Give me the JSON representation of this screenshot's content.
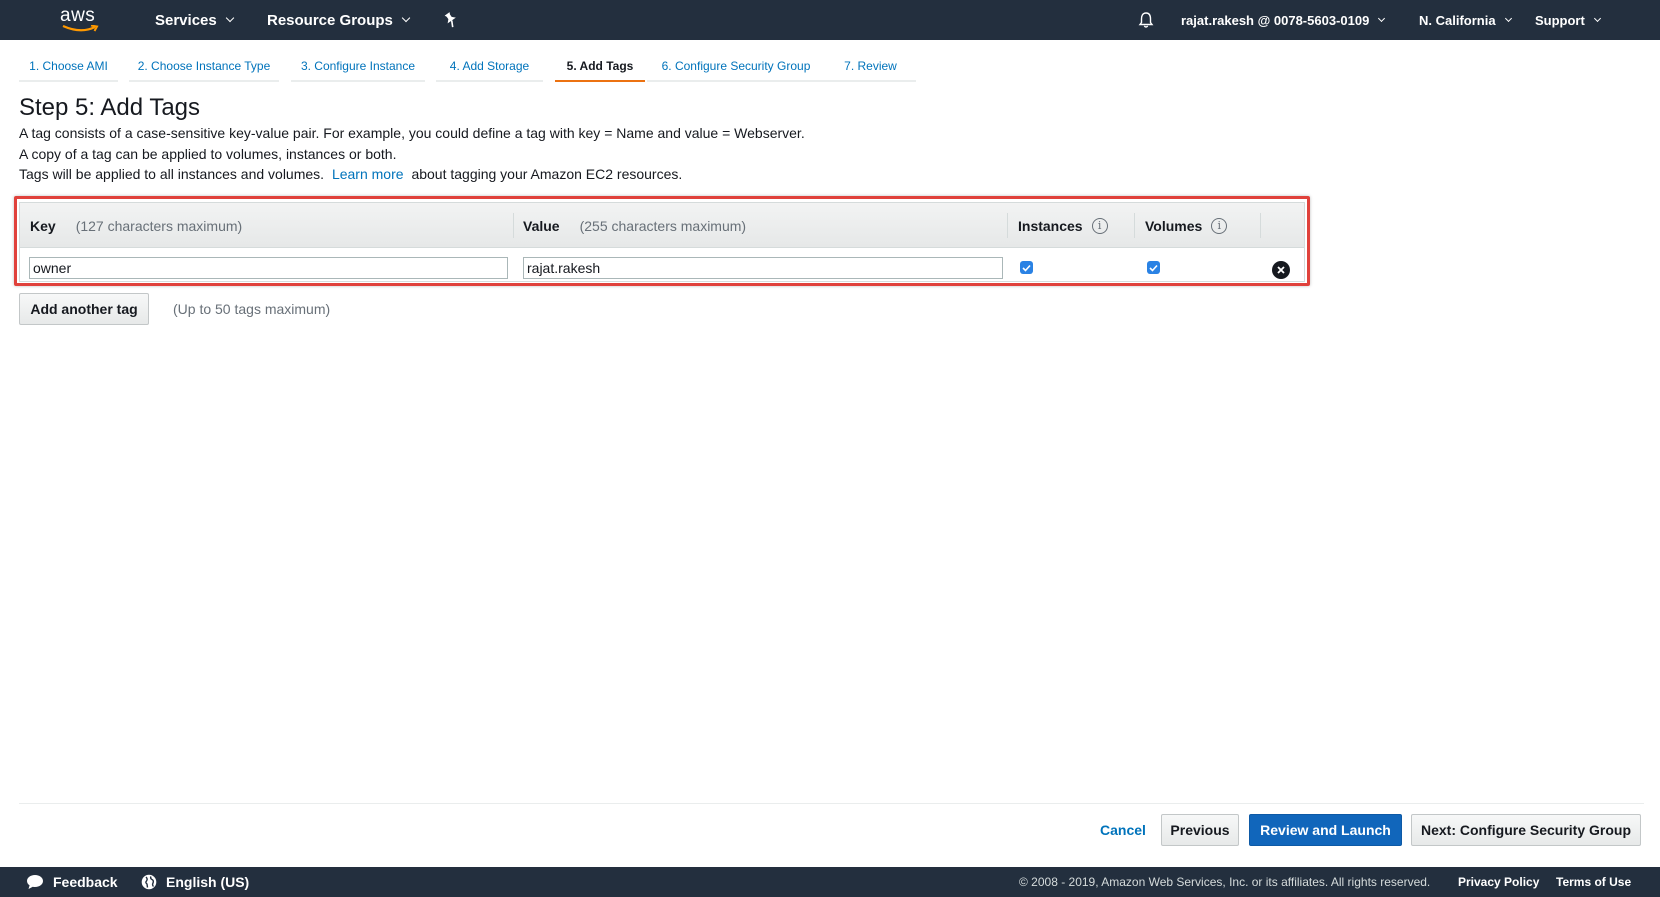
{
  "header": {
    "logo_text": "aws",
    "services": "Services",
    "resource_groups": "Resource Groups",
    "account": "rajat.rakesh @ 0078-5603-0109",
    "region": "N. California",
    "support": "Support",
    "icons": [
      "pin-icon",
      "bell-icon"
    ]
  },
  "wizard": {
    "tabs": [
      {
        "label": "1. Choose AMI"
      },
      {
        "label": "2. Choose Instance Type"
      },
      {
        "label": "3. Configure Instance"
      },
      {
        "label": "4. Add Storage"
      },
      {
        "label": "5. Add Tags",
        "active": true
      },
      {
        "label": "6. Configure Security Group"
      },
      {
        "label": "7. Review"
      }
    ]
  },
  "page": {
    "title": "Step 5: Add Tags",
    "line1": "A tag consists of a case-sensitive key-value pair. For example, you could define a tag with key = Name and value = Webserver.",
    "line2": "A copy of a tag can be applied to volumes, instances or both.",
    "line3_pre": "Tags will be applied to all instances and volumes.",
    "line3_link": "Learn more",
    "line3_post": "about tagging your Amazon EC2 resources."
  },
  "tags_table": {
    "columns": {
      "key": "Key",
      "key_hint": "(127 characters maximum)",
      "value": "Value",
      "value_hint": "(255 characters maximum)",
      "instances": "Instances",
      "volumes": "Volumes"
    },
    "rows": [
      {
        "key": "owner",
        "value": "rajat.rakesh",
        "instances": true,
        "volumes": true
      }
    ]
  },
  "add_tag": {
    "button": "Add another tag",
    "note": "(Up to 50 tags maximum)"
  },
  "actions": {
    "cancel": "Cancel",
    "previous": "Previous",
    "review_launch": "Review and Launch",
    "next": "Next: Configure Security Group"
  },
  "footer": {
    "feedback": "Feedback",
    "language": "English (US)",
    "copyright": "© 2008 - 2019, Amazon Web Services, Inc. or its affiliates. All rights reserved.",
    "privacy": "Privacy Policy",
    "terms": "Terms of Use"
  },
  "colors": {
    "nav_bg": "#232f3e",
    "link": "#0073bb",
    "active_tab": "#ec7211",
    "primary_button": "#1166bb",
    "highlight_border": "#e0413b"
  }
}
